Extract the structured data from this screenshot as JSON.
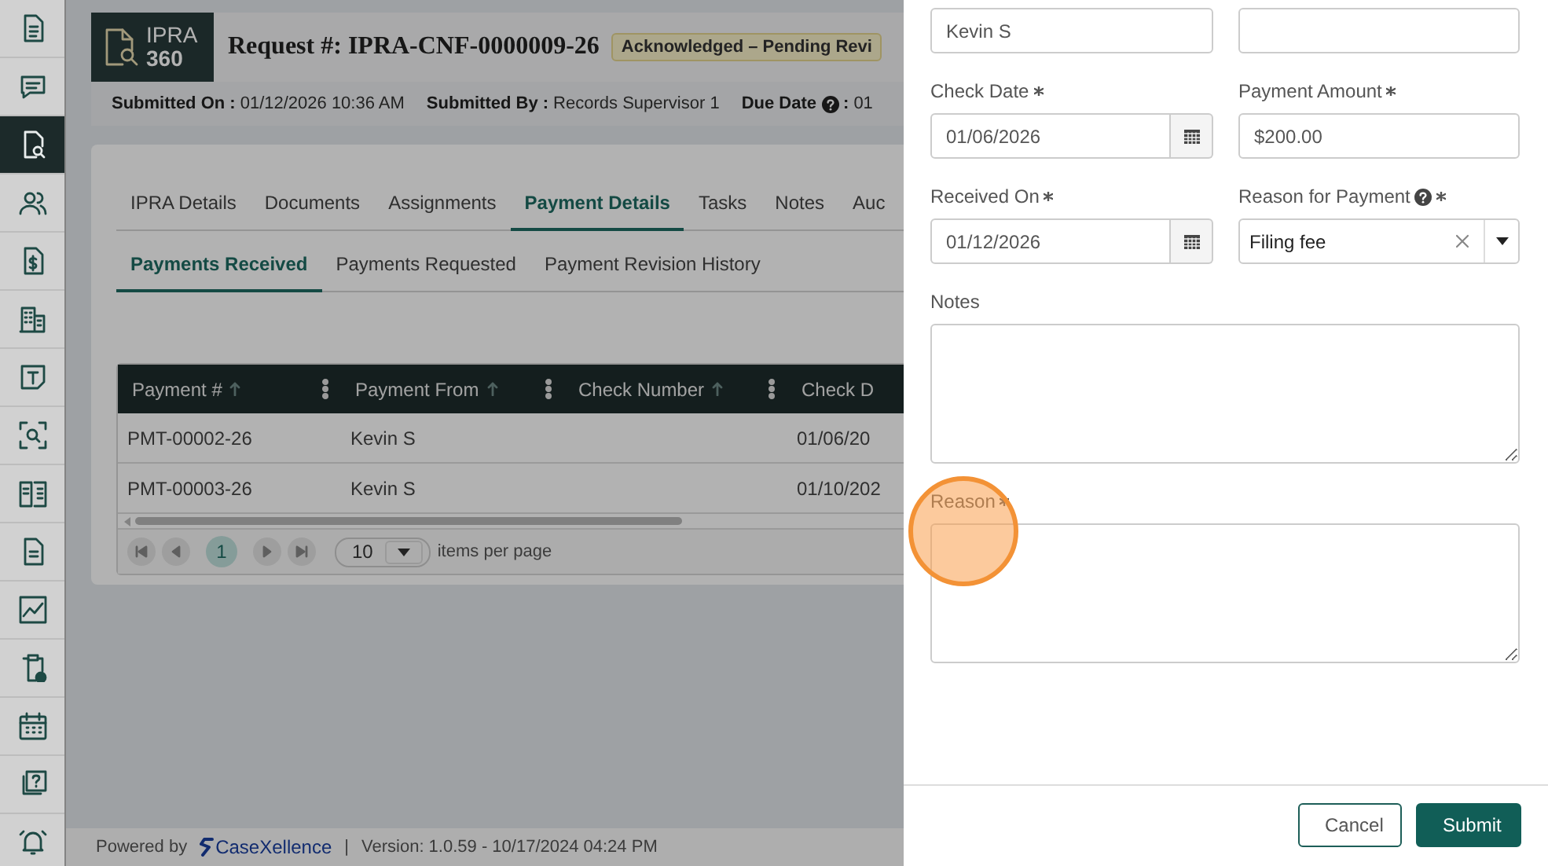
{
  "sidebar": {
    "items": [
      {
        "selected": false
      },
      {
        "selected": false
      },
      {
        "selected": true
      },
      {
        "selected": false
      },
      {
        "selected": false
      },
      {
        "selected": false
      },
      {
        "selected": false
      },
      {
        "selected": false
      },
      {
        "selected": false
      },
      {
        "selected": false
      },
      {
        "selected": false
      },
      {
        "selected": false
      },
      {
        "selected": false
      },
      {
        "selected": false
      },
      {
        "selected": false
      }
    ]
  },
  "header": {
    "logo": {
      "line1": "IPRA",
      "line2": "360"
    },
    "title": "Request #: IPRA-CNF-0000009-26",
    "status": "Acknowledged – Pending Revi"
  },
  "meta": [
    {
      "label": "Submitted On :",
      "value": "01/12/2026 10:36 AM",
      "help": false
    },
    {
      "label": "Submitted By :",
      "value": "Records Supervisor 1",
      "help": false
    },
    {
      "label": "Due Date",
      "label_end": ":",
      "value": "01",
      "help": true
    }
  ],
  "tabs": [
    {
      "label": "IPRA Details",
      "selected": false
    },
    {
      "label": "Documents",
      "selected": false
    },
    {
      "label": "Assignments",
      "selected": false
    },
    {
      "label": "Payment Details",
      "selected": true
    },
    {
      "label": "Tasks",
      "selected": false
    },
    {
      "label": "Notes",
      "selected": false
    },
    {
      "label": "Auc",
      "selected": false
    }
  ],
  "subtabs": [
    {
      "label": "Payments Received",
      "selected": true
    },
    {
      "label": "Payments Requested",
      "selected": false
    },
    {
      "label": "Payment Revision History",
      "selected": false
    }
  ],
  "table": {
    "columns": [
      "Payment #",
      "Payment From",
      "Check Number",
      "Check D"
    ],
    "rows": [
      [
        "PMT-00002-26",
        "Kevin S",
        "",
        "01/06/20"
      ],
      [
        "PMT-00003-26",
        "Kevin S",
        "",
        "01/10/202"
      ]
    ],
    "pager": {
      "pages": [
        {
          "label": "1",
          "selected": true
        }
      ],
      "page_size": "10",
      "page_size_label": "items per page"
    }
  },
  "footer": {
    "powered_by": "Powered by",
    "brand": "CaseXellence",
    "separator": "|",
    "version": "Version: 1.0.59 - 10/17/2024 04:24 PM"
  },
  "drawer": {
    "fields": [
      {
        "kind": "text",
        "value": "Kevin S"
      },
      {
        "kind": "text"
      },
      {
        "kind": "date",
        "label": "Check Date",
        "required": true,
        "value": "01/06/2026"
      },
      {
        "kind": "text",
        "label": "Payment Amount",
        "required": true,
        "value": "$200.00"
      },
      {
        "kind": "date",
        "label": "Received On",
        "required": true,
        "value": "01/12/2026"
      },
      {
        "kind": "select",
        "label": "Reason for Payment",
        "help": true,
        "required": true,
        "value": "Filing fee"
      },
      {
        "kind": "textarea",
        "label": "Notes",
        "required": false
      },
      {
        "kind": "textarea",
        "label": "Reason",
        "required": true
      }
    ],
    "buttons": [
      {
        "label": "Cancel",
        "kind": "secondary"
      },
      {
        "label": "Submit",
        "kind": "primary"
      }
    ]
  }
}
